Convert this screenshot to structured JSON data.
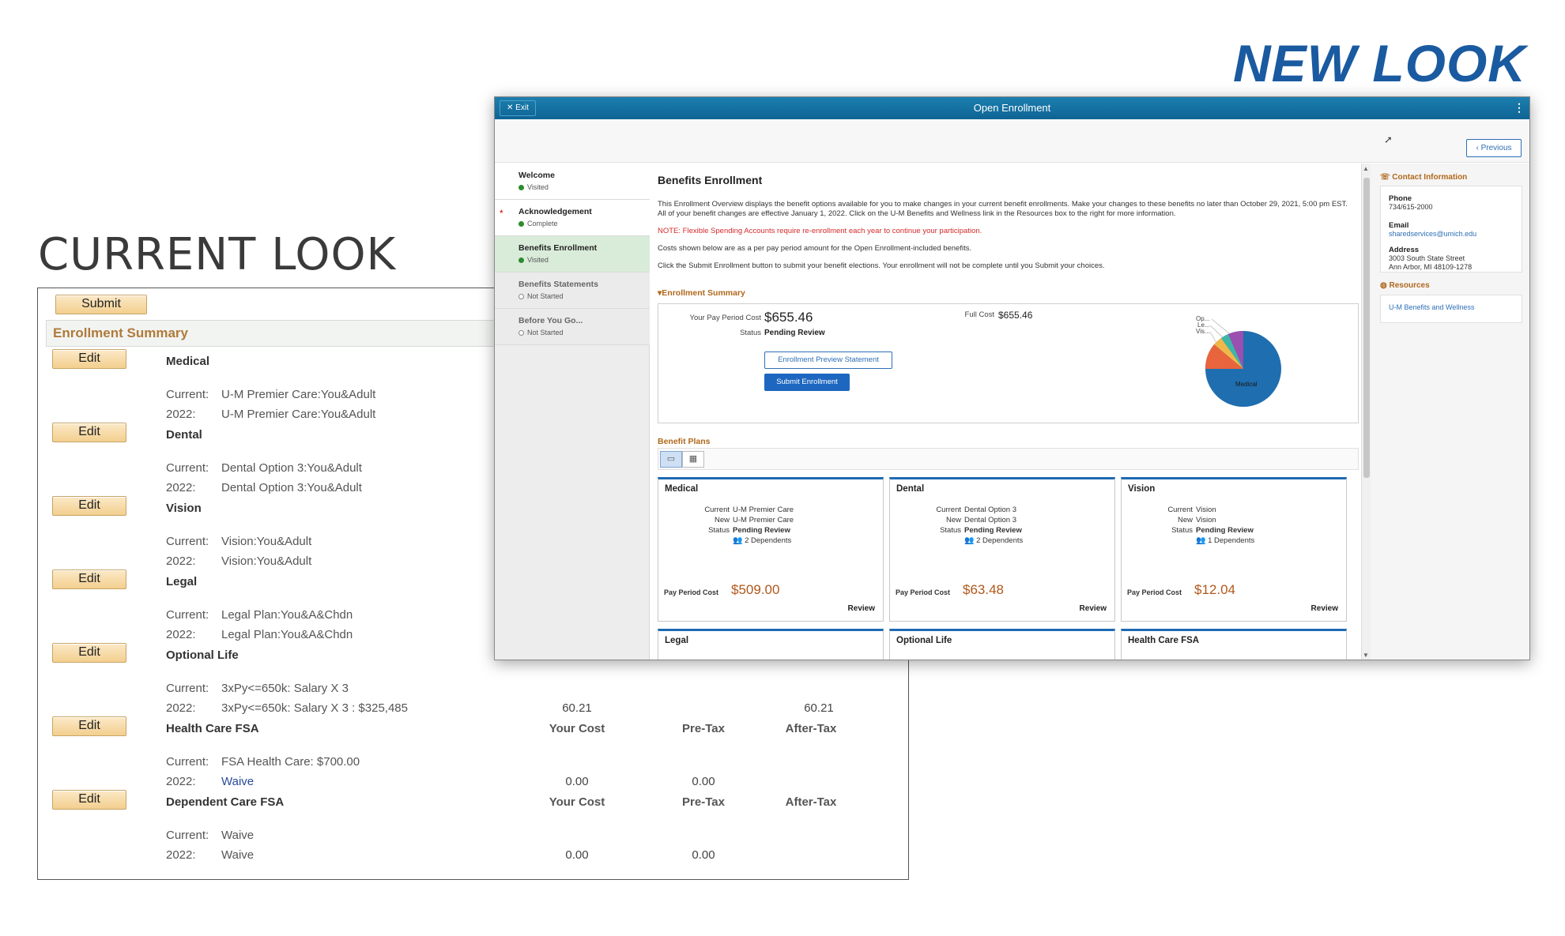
{
  "headings": {
    "new_look": "NEW LOOK",
    "current_look": "CURRENT LOOK"
  },
  "old_ui": {
    "submit_label": "Submit",
    "summary_title": "Enrollment Summary",
    "edit_label": "Edit",
    "sections": [
      {
        "name": "Medical",
        "current_label": "Current:",
        "current": "U-M Premier Care:You&Adult",
        "new_label": "2022:",
        "new": "U-M Premier Care:You&Adult"
      },
      {
        "name": "Dental",
        "current_label": "Current:",
        "current": "Dental Option 3:You&Adult",
        "new_label": "2022:",
        "new": "Dental Option 3:You&Adult"
      },
      {
        "name": "Vision",
        "current_label": "Current:",
        "current": "Vision:You&Adult",
        "new_label": "2022:",
        "new": "Vision:You&Adult"
      },
      {
        "name": "Legal",
        "current_label": "Current:",
        "current": "Legal Plan:You&A&Chdn",
        "new_label": "2022:",
        "new": "Legal Plan:You&A&Chdn"
      },
      {
        "name": "Optional Life",
        "current_label": "Current:",
        "current": "3xPy<=650k: Salary X 3",
        "new_label": "2022:",
        "new": "3xPy<=650k: Salary X 3 : $325,485"
      },
      {
        "name": "Health Care FSA",
        "current_label": "Current:",
        "current": "FSA Health Care: $700.00",
        "new_label": "2022:",
        "new": "Waive"
      },
      {
        "name": "Dependent Care FSA",
        "current_label": "Current:",
        "current": "Waive",
        "new_label": "2022:",
        "new": "Waive"
      }
    ],
    "col_headers": {
      "your_cost": "Your Cost",
      "pre_tax": "Pre-Tax",
      "after_tax": "After-Tax"
    },
    "optional_life_values": {
      "your_cost": "60.21",
      "after_tax": "60.21"
    },
    "hcfsa_values": {
      "your_cost": "0.00",
      "pre_tax": "0.00"
    },
    "dcfsa_values": {
      "your_cost": "0.00",
      "pre_tax": "0.00"
    }
  },
  "new_ui": {
    "exit_label": "Exit",
    "window_title": "Open Enrollment",
    "previous_label": "Previous",
    "nav": [
      {
        "title": "Welcome",
        "status": "Visited"
      },
      {
        "title": "Acknowledgement",
        "status": "Complete"
      },
      {
        "title": "Benefits Enrollment",
        "status": "Visited"
      },
      {
        "title": "Benefits Statements",
        "status": "Not Started"
      },
      {
        "title": "Before You Go...",
        "status": "Not Started"
      }
    ],
    "main_title": "Benefits Enrollment",
    "para1": "This Enrollment Overview displays the benefit options available for you to make changes in your current benefit enrollments. Make your changes to these benefits no later than October 29, 2021, 5:00 pm EST. All of your benefit changes are effective January 1, 2022. Click on the U-M Benefits and Wellness link in the Resources box to the right for more information.",
    "note": "NOTE: Flexible Spending Accounts require re-enrollment each year to continue your participation.",
    "para2": "Costs shown below are as a per pay period amount for the Open Enrollment-included benefits.",
    "para3": "Click the Submit Enrollment button to submit your benefit elections. Your enrollment will not be complete until you Submit your choices.",
    "summary": {
      "toggle": "Enrollment Summary",
      "ppc_label": "Your Pay Period Cost",
      "ppc_value": "$655.46",
      "status_label": "Status",
      "status_value": "Pending Review",
      "full_cost_label": "Full Cost",
      "full_cost_value": "$655.46",
      "preview_btn": "Enrollment Preview Statement",
      "submit_btn": "Submit Enrollment",
      "pie_labels": [
        "Op...",
        "Le...",
        "Vis..."
      ],
      "pie_main_label": "Medical"
    },
    "benefit_plans_title": "Benefit Plans",
    "cards": [
      {
        "title": "Medical",
        "current_label": "Current",
        "current": "U-M Premier Care",
        "new_label": "New",
        "new": "U-M Premier Care",
        "status_label": "Status",
        "status": "Pending Review",
        "dependents": "2 Dependents",
        "ppc_label": "Pay Period Cost",
        "ppc": "$509.00",
        "review": "Review"
      },
      {
        "title": "Dental",
        "current_label": "Current",
        "current": "Dental Option 3",
        "new_label": "New",
        "new": "Dental Option 3",
        "status_label": "Status",
        "status": "Pending Review",
        "dependents": "2 Dependents",
        "ppc_label": "Pay Period Cost",
        "ppc": "$63.48",
        "review": "Review"
      },
      {
        "title": "Vision",
        "current_label": "Current",
        "current": "Vision",
        "new_label": "New",
        "new": "Vision",
        "status_label": "Status",
        "status": "Pending Review",
        "dependents": "1 Dependents",
        "ppc_label": "Pay Period Cost",
        "ppc": "$12.04",
        "review": "Review"
      }
    ],
    "cards_row2": [
      "Legal",
      "Optional Life",
      "Health Care FSA"
    ],
    "contact": {
      "title": "Contact Information",
      "phone_label": "Phone",
      "phone": "734/615-2000",
      "email_label": "Email",
      "email": "sharedservices@umich.edu",
      "address_label": "Address",
      "address1": "3003 South State Street",
      "address2": "Ann Arbor, MI 48109-1278"
    },
    "resources": {
      "title": "Resources",
      "link": "U-M Benefits and Wellness"
    }
  }
}
